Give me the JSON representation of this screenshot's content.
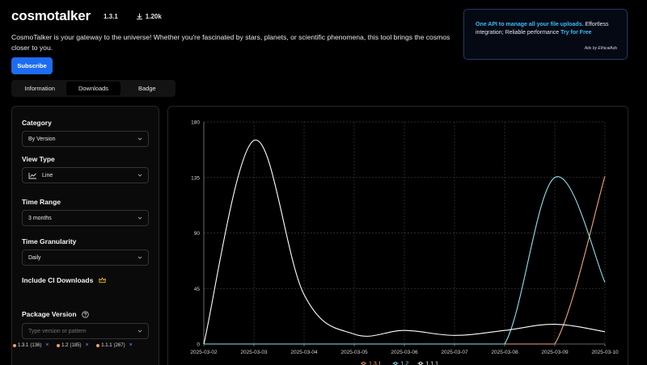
{
  "header": {
    "package_name": "cosmotalker",
    "version_badge": "1.3.1",
    "downloads_badge": "1.20k"
  },
  "description": "CosmoTalker is your gateway to the universe! Whether you're fascinated by stars, planets, or scientific phenomena, this tool brings the cosmos closer to you.",
  "subscribe_label": "Subscribe",
  "ad": {
    "headline": "One API to manage all your file uploads.",
    "body": " Effortless integration; Reliable performance ",
    "cta": "Try for Free",
    "footer": "Ads by EthicalAds"
  },
  "tabs": [
    {
      "label": "Information",
      "active": false
    },
    {
      "label": "Downloads",
      "active": true
    },
    {
      "label": "Badge",
      "active": false
    }
  ],
  "sidebar": {
    "category_label": "Category",
    "category_value": "By Version",
    "view_type_label": "View Type",
    "view_type_value": "Line",
    "time_range_label": "Time Range",
    "time_range_value": "3 months",
    "granularity_label": "Time Granularity",
    "granularity_value": "Daily",
    "ci_label": "Include CI Downloads",
    "package_version_label": "Package Version",
    "package_version_placeholder": "Type version or pattern",
    "version_tags": [
      {
        "name": "1.3.1",
        "count": "(136)",
        "color": "#f0a060"
      },
      {
        "name": "1.2",
        "count": "(185)",
        "color": "#f0a060"
      },
      {
        "name": "1.1.1",
        "count": "(267)",
        "color": "#f0a060"
      }
    ]
  },
  "chart_data": {
    "type": "line",
    "x": [
      "2025-03-02",
      "2025-03-03",
      "2025-03-04",
      "2025-03-05",
      "2025-03-06",
      "2025-03-07",
      "2025-03-08",
      "2025-03-09",
      "2025-03-10"
    ],
    "ylim": [
      0,
      180
    ],
    "yticks": [
      0,
      45,
      90,
      135,
      180
    ],
    "grid": true,
    "legend_position": "bottom",
    "series": [
      {
        "name": "1.3.1",
        "color": "#f0a878",
        "values": [
          0,
          0,
          0,
          0,
          0,
          0,
          0,
          0,
          136
        ]
      },
      {
        "name": "1.2",
        "color": "#8ee0f0",
        "values": [
          0,
          0,
          0,
          0,
          0,
          0,
          0,
          135,
          50
        ]
      },
      {
        "name": "1.1.1",
        "color": "#ffffff",
        "values": [
          0,
          165,
          40,
          8,
          11,
          7,
          11,
          16,
          10
        ]
      }
    ]
  }
}
